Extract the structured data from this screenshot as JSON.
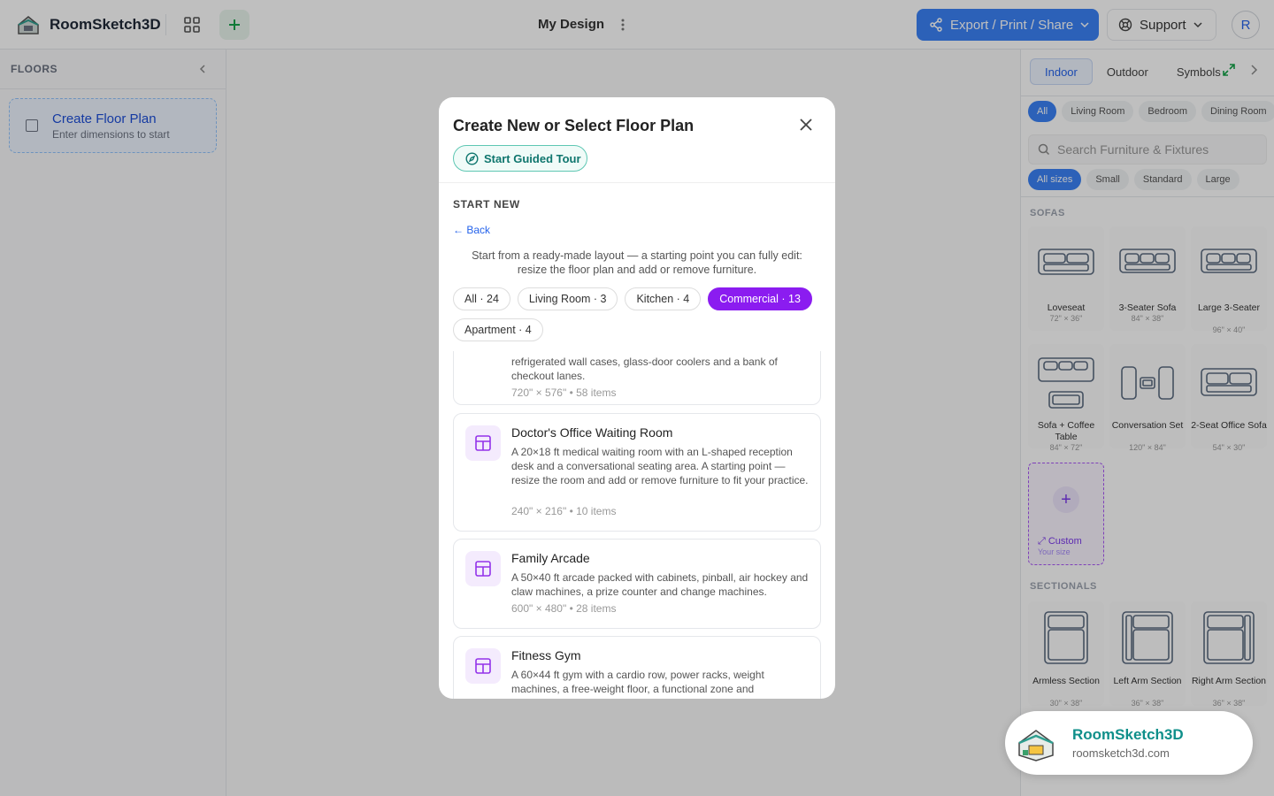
{
  "app": {
    "name": "RoomSketch3D",
    "design_title": "My Design"
  },
  "header": {
    "export_label": "Export / Print / Share",
    "support_label": "Support",
    "avatar_initial": "R"
  },
  "floors": {
    "heading": "FLOORS",
    "create_title": "Create Floor Plan",
    "create_sub": "Enter dimensions to start"
  },
  "library": {
    "tabs": [
      "Indoor",
      "Outdoor",
      "Symbols"
    ],
    "rooms": [
      "All",
      "Living Room",
      "Bedroom",
      "Dining Room"
    ],
    "search_placeholder": "Search Furniture & Fixtures",
    "sizes": [
      "All sizes",
      "Small",
      "Standard",
      "Large"
    ],
    "sofas_heading": "SOFAS",
    "sofas": [
      {
        "name": "Loveseat",
        "dim": "72\" × 36\""
      },
      {
        "name": "3-Seater Sofa",
        "dim": "84\" × 38\""
      },
      {
        "name": "Large 3-Seater",
        "dim": "96\" × 40\""
      },
      {
        "name": "Sofa + Coffee Table",
        "dim": "84\" × 72\""
      },
      {
        "name": "Conversation Set",
        "dim": "120\" × 84\""
      },
      {
        "name": "2-Seat Office Sofa",
        "dim": "54\" × 30\""
      }
    ],
    "custom_label": "Custom",
    "custom_sub": "Your size",
    "sectionals_heading": "SECTIONALS",
    "sectionals": [
      {
        "name": "Armless Section",
        "dim": "30\" × 38\""
      },
      {
        "name": "Left Arm Section",
        "dim": "36\" × 38\""
      },
      {
        "name": "Right Arm Section",
        "dim": "36\" × 38\""
      }
    ]
  },
  "modal": {
    "title": "Create New or Select Floor Plan",
    "tour_label": "Start Guided Tour",
    "start_new": "START NEW",
    "back_label": "← Back",
    "description": "Start from a ready-made layout — a starting point you can fully edit: resize the floor plan and add or remove furniture.",
    "filters": [
      "All · 24",
      "Living Room · 3",
      "Kitchen · 4",
      "Commercial · 13",
      "Apartment · 4"
    ],
    "active_filter": "Commercial · 13",
    "templates": [
      {
        "name": "",
        "desc": "refrigerated wall cases, glass-door coolers and a bank of checkout lanes.",
        "meta": "720\" × 576\" • 58 items"
      },
      {
        "name": "Doctor's Office Waiting Room",
        "desc": "A 20×18 ft medical waiting room with an L-shaped reception desk and a conversational seating area. A starting point — resize the room and add or remove furniture to fit your practice.",
        "meta": "240\" × 216\" • 10 items"
      },
      {
        "name": "Family Arcade",
        "desc": "A 50×40 ft arcade packed with cabinets, pinball, air hockey and claw machines, a prize counter and change machines.",
        "meta": "600\" × 480\" • 28 items"
      },
      {
        "name": "Fitness Gym",
        "desc": "A 60×44 ft gym with a cardio row, power racks, weight machines, a free-weight floor, a functional zone and",
        "meta": ""
      }
    ]
  },
  "watermark": {
    "title": "RoomSketch3D",
    "url": "roomsketch3d.com"
  },
  "colors": {
    "accent_blue": "#3b82f6",
    "accent_purple": "#8b1cf0",
    "accent_teal": "#0f766e"
  }
}
